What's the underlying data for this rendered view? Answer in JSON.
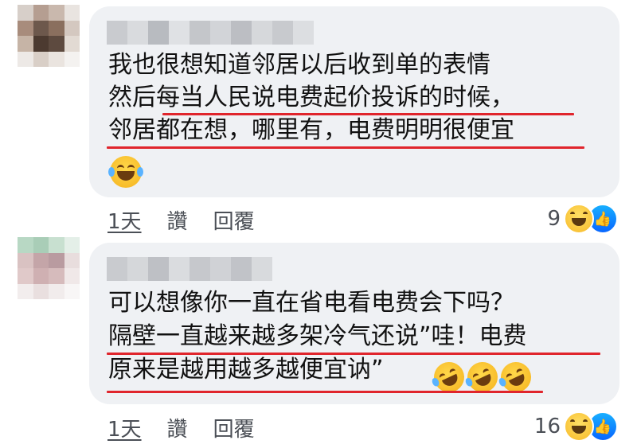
{
  "comments": [
    {
      "lines": [
        {
          "plain": "我也很想知道邻居以后收到单的表情",
          "underlined": ""
        },
        {
          "plain": "然后",
          "underlined": "每当人民说电费起价投诉的时候，"
        },
        {
          "plain": "",
          "underlined": "邻居都在想，哪里有，电费明明很便宜"
        }
      ],
      "trailing_emoji": "face-with-tears-of-joy",
      "time": "1天",
      "like_label": "讚",
      "reply_label": "回覆",
      "reaction_count": "9"
    },
    {
      "lines": [
        {
          "plain": "可以想像你一直在省电看电费会下吗？",
          "underlined": ""
        },
        {
          "plain": "",
          "underlined": "隔壁一直越来越多架冷气还说”哇！电费"
        },
        {
          "plain": "",
          "underlined": "原来是越用越多越便宜讷”"
        }
      ],
      "trailing_emoji": "rolling-on-the-floor-laughing x3",
      "time": "1天",
      "like_label": "讚",
      "reply_label": "回覆",
      "reaction_count": "16"
    }
  ],
  "colors": {
    "underline": "#e0252c",
    "bubble": "#eff1f4",
    "like": "#0866ff"
  }
}
